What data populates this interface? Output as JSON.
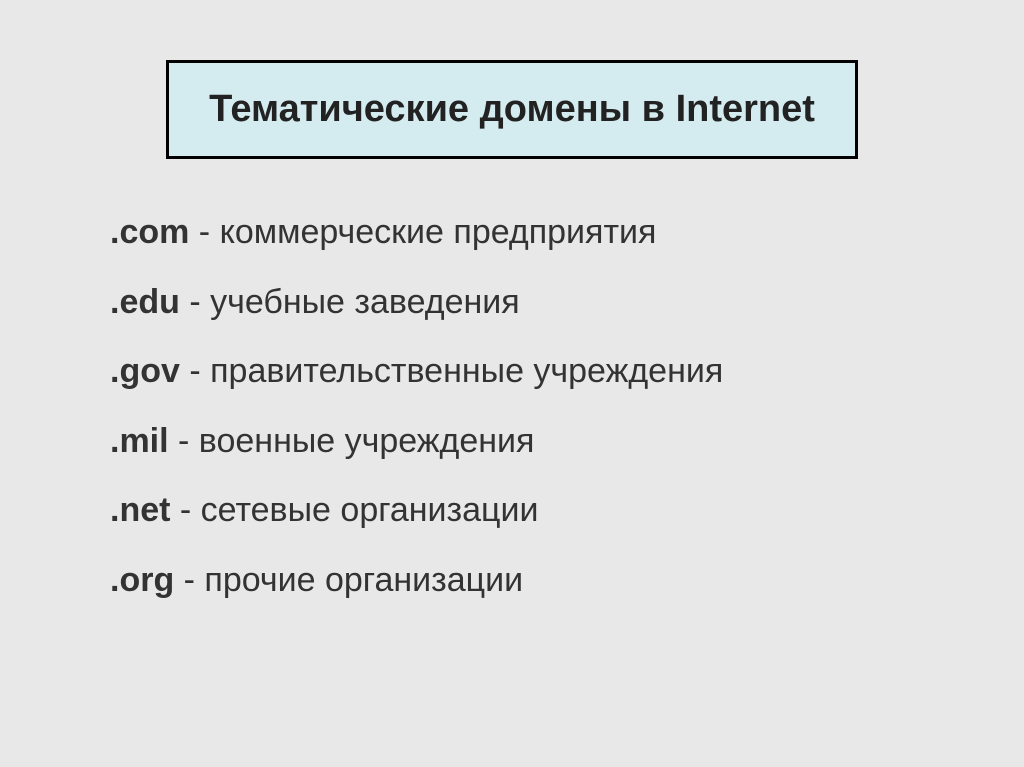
{
  "title": "Тематические домены в Internet",
  "domains": [
    {
      "name": ".com",
      "description": " - коммерческие предприятия"
    },
    {
      "name": ".edu",
      "description": " - учебные заведения"
    },
    {
      "name": ".gov",
      "description": " - правительственные учреждения"
    },
    {
      "name": ".mil",
      "description": " - военные учреждения"
    },
    {
      "name": ".net",
      "description": " - сетевые организации"
    },
    {
      "name": ".org",
      "description": " - прочие организации"
    }
  ]
}
